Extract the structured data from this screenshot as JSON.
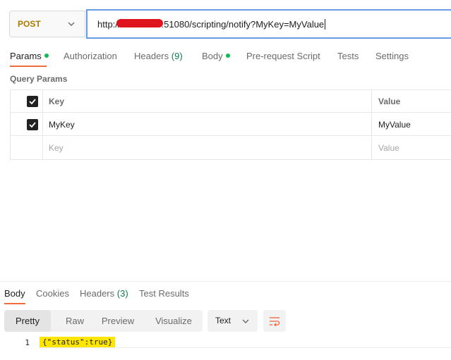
{
  "request": {
    "method": "POST",
    "url_prefix": "http://",
    "url_suffix": ":51080/scripting/notify?MyKey=MyValue"
  },
  "tabs": [
    {
      "label": "Params",
      "active": true,
      "dot": true
    },
    {
      "label": "Authorization"
    },
    {
      "label": "Headers",
      "count": "(9)"
    },
    {
      "label": "Body",
      "dot": true
    },
    {
      "label": "Pre-request Script"
    },
    {
      "label": "Tests"
    },
    {
      "label": "Settings"
    }
  ],
  "query_params": {
    "title": "Query Params",
    "columns": [
      "Key",
      "Value"
    ],
    "rows": [
      {
        "checked": true,
        "key": "MyKey",
        "value": "MyValue"
      }
    ],
    "placeholder": {
      "key": "Key",
      "value": "Value"
    }
  },
  "response": {
    "tabs": [
      {
        "label": "Body",
        "active": true
      },
      {
        "label": "Cookies"
      },
      {
        "label": "Headers",
        "count": "(3)"
      },
      {
        "label": "Test Results"
      }
    ],
    "view_modes": [
      "Pretty",
      "Raw",
      "Preview",
      "Visualize"
    ],
    "active_mode": "Pretty",
    "format": "Text",
    "line_number": "1",
    "body": "{\"status\":true}"
  },
  "colors": {
    "method": "#ad7a03",
    "accent": "#f26b3a",
    "url_focus": "#6a9be6",
    "dot": "#0cbb52",
    "highlight": "#ffe600",
    "redaction": "#e0141e"
  }
}
